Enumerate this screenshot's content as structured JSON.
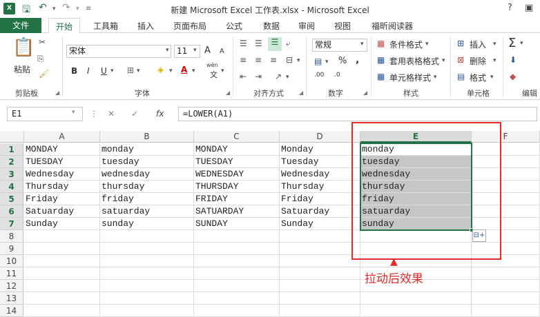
{
  "app": {
    "window_title": "新建 Microsoft Excel 工作表.xlsx - Microsoft Excel",
    "help": "?",
    "logo": "X"
  },
  "tabs": [
    {
      "label": "文件"
    },
    {
      "label": "开始"
    },
    {
      "label": "工具箱"
    },
    {
      "label": "插入"
    },
    {
      "label": "页面布局"
    },
    {
      "label": "公式"
    },
    {
      "label": "数据"
    },
    {
      "label": "审阅"
    },
    {
      "label": "视图"
    },
    {
      "label": "福昕阅读器"
    }
  ],
  "ribbon": {
    "clipboard": {
      "paste": "粘贴",
      "group": "剪贴板"
    },
    "font": {
      "name": "宋体",
      "size": "11",
      "bold": "B",
      "italic": "I",
      "underline": "U",
      "grow": "A",
      "shrink": "A",
      "wen": "wén",
      "wen_char": "文",
      "group": "字体"
    },
    "align": {
      "group": "对齐方式"
    },
    "number": {
      "format": "常规",
      "percent": "%",
      "comma": ",",
      "dec_up": ".00",
      "dec_down": ".0",
      "group": "数字"
    },
    "styles": {
      "cond": "条件格式",
      "table": "套用表格格式",
      "cell": "单元格样式",
      "group": "样式"
    },
    "cells": {
      "insert": "插入",
      "delete": "删除",
      "format": "格式",
      "group": "单元格"
    },
    "edit": {
      "group": "编辑",
      "sigma": "Σ"
    }
  },
  "formula_bar": {
    "name_box": "E1",
    "formula": "=LOWER(A1)",
    "fx": "fx"
  },
  "columns": [
    "A",
    "B",
    "C",
    "D",
    "E",
    "F"
  ],
  "rows": [
    "1",
    "2",
    "3",
    "4",
    "5",
    "6",
    "7",
    "8",
    "9",
    "10",
    "11",
    "12",
    "13",
    "14"
  ],
  "cells": {
    "A": [
      "MONDAY",
      "TUESDAY",
      "Wednesday",
      "Thursday",
      "Friday",
      "Satuarday",
      "Sunday"
    ],
    "B": [
      "monday",
      "tuesday",
      "wednesday",
      "thursday",
      "friday",
      "satuarday",
      "sunday"
    ],
    "C": [
      "MONDAY",
      "TUESDAY",
      "WEDNESDAY",
      "THURSDAY",
      "FRIDAY",
      "SATUARDAY",
      "SUNDAY"
    ],
    "D": [
      "Monday",
      "Tuesday",
      "Wednesday",
      "Thursday",
      "Friday",
      "Satuarday",
      "Sunday"
    ],
    "E": [
      "monday",
      "tuesday",
      "wednesday",
      "thursday",
      "friday",
      "satuarday",
      "sunday"
    ]
  },
  "annotation": "拉动后效果",
  "colors": {
    "accent": "#217346",
    "annotation": "#e52a2a",
    "highlight": "#c6c6c6"
  }
}
